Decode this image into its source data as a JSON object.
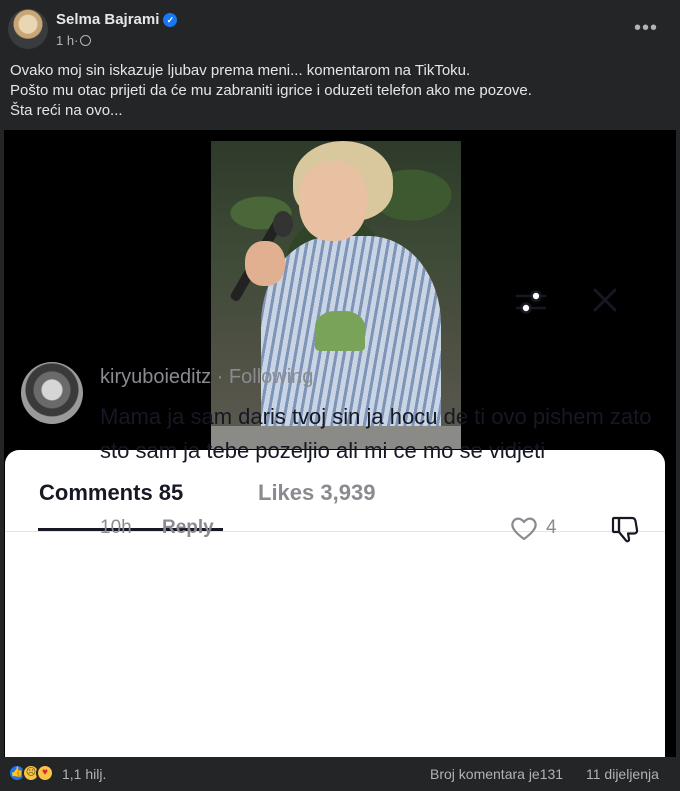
{
  "post": {
    "author": "Selma Bajrami",
    "time": "1 h",
    "separator": "·",
    "more_icon": "•••",
    "verified_icon": "✓",
    "text_lines": [
      "Ovako moj sin iskazuje ljubav prema meni... komentarom na TikToku.",
      "Pošto mu otac prijeti da će mu zabraniti igrice i oduzeti telefon ako me pozove.",
      "Šta reći na ovo..."
    ]
  },
  "tiktok": {
    "tab_comments": "Comments 85",
    "tab_likes": "Likes 3,939",
    "comment": {
      "username": "kiryuboieditz · Following",
      "text": "Mama ja sam daris tvoj sin ja hocu de ti ovo pishem zato sto sam ja tebe pozeljio ali mi ce mo se vidjeti",
      "time": "10h",
      "reply": "Reply",
      "likes": "4"
    }
  },
  "footer": {
    "reactions": "1,1 hilj.",
    "comments": "Broj komentara je131",
    "shares": "11 dijeljenja"
  },
  "icons": [
    "avatar",
    "verified-icon",
    "globe-icon",
    "more-icon",
    "filter-icon",
    "close-icon",
    "heart-icon",
    "dislike-icon",
    "like-reaction-icon",
    "sad-reaction-icon",
    "care-reaction-icon"
  ],
  "colors": {
    "background": "#242526",
    "text": "#e4e6eb",
    "muted": "#b0b3b8",
    "accent": "#1877f2"
  }
}
